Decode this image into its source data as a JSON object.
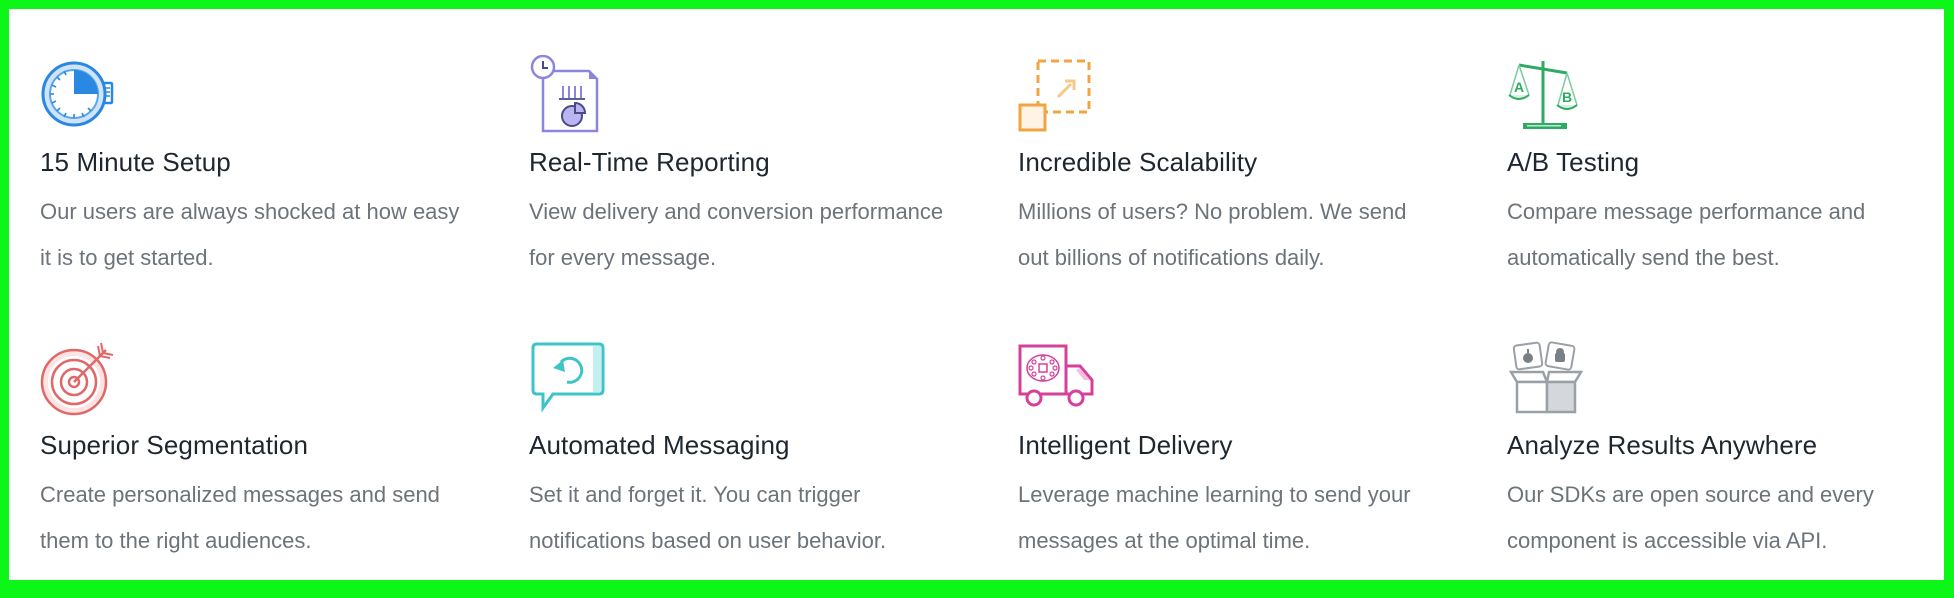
{
  "features": [
    {
      "title": "15 Minute Setup",
      "description": "Our users are always shocked at how easy it is to get started.",
      "icon": "stopwatch-icon",
      "color": "#2a88e0"
    },
    {
      "title": "Real-Time Reporting",
      "description": "View delivery and conversion performance for every message.",
      "icon": "report-document-icon",
      "color": "#8a86e0"
    },
    {
      "title": "Incredible Scalability",
      "description": "Millions of users? No problem. We send out billions of notifications daily.",
      "icon": "scale-up-icon",
      "color": "#f0a540"
    },
    {
      "title": "A/B Testing",
      "description": "Compare message performance and automatically send the best.",
      "icon": "balance-scale-icon",
      "color": "#2eaa64",
      "icon_labels": [
        "A",
        "B"
      ]
    },
    {
      "title": "Superior Segmentation",
      "description": "Create personalized messages and send them to the right audiences.",
      "icon": "target-icon",
      "color": "#e06868"
    },
    {
      "title": "Automated Messaging",
      "description": "Set it and forget it. You can trigger notifications based on user behavior.",
      "icon": "chat-refresh-icon",
      "color": "#3cc4c8"
    },
    {
      "title": "Intelligent Delivery",
      "description": "Leverage machine learning to send your messages at the optimal time.",
      "icon": "delivery-truck-icon",
      "color": "#d6409a"
    },
    {
      "title": "Analyze Results Anywhere",
      "description": "Our SDKs are open source and every component is accessible via API.",
      "icon": "sdk-box-icon",
      "color": "#9aa0a8"
    }
  ]
}
